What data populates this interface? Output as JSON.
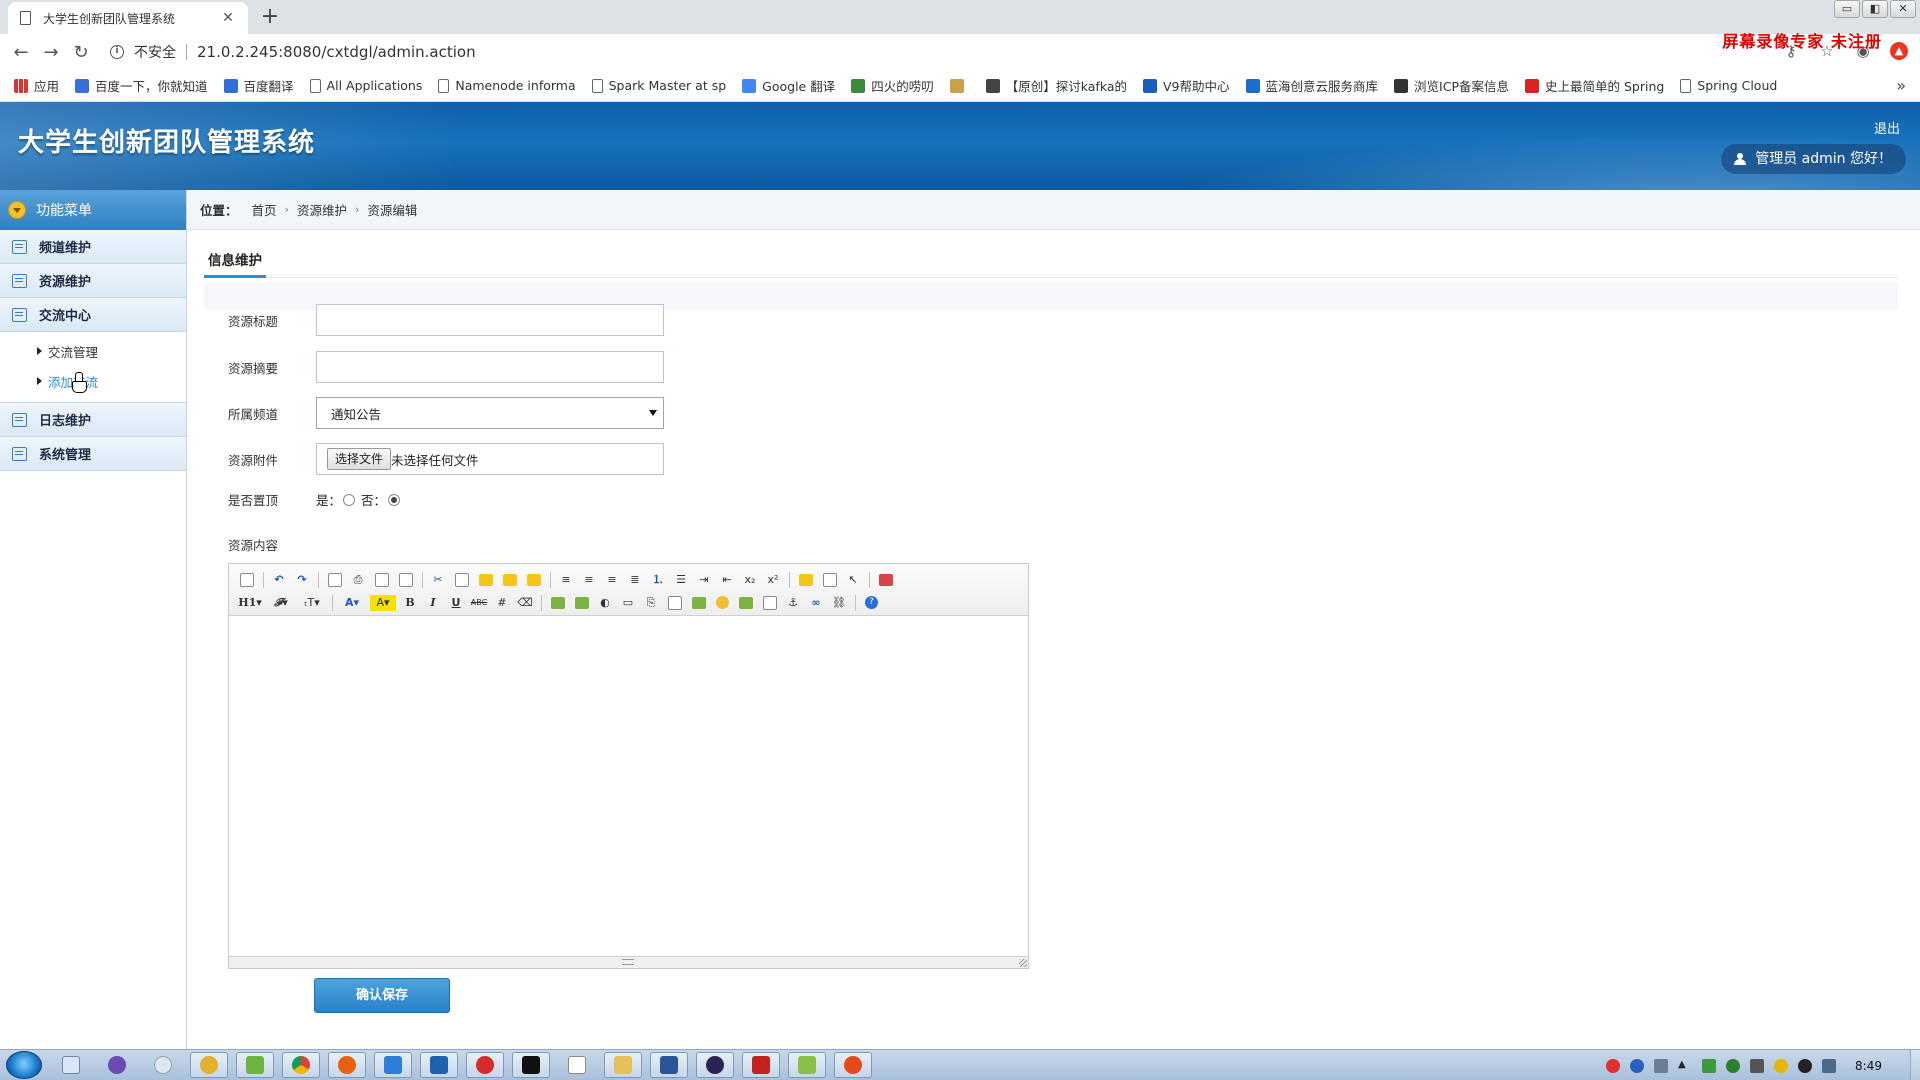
{
  "browser": {
    "tab_title": "大学生创新团队管理系统",
    "tab_close": "✕",
    "new_tab": "+",
    "back": "←",
    "forward": "→",
    "reload": "↻",
    "security_icon": "info-circle-icon",
    "security_label": "不安全",
    "url": "21.0.2.245:8080/cxtdgl/admin.action",
    "window_controls": [
      "▭",
      "◧",
      "✕"
    ],
    "bookmarks": [
      {
        "icon": "apps-icon",
        "label": "应用"
      },
      {
        "icon": "baidu-paw-icon",
        "label": "百度一下，你就知道"
      },
      {
        "icon": "baidu-fanyi-icon",
        "label": "百度翻译"
      },
      {
        "icon": "document-icon",
        "label": "All Applications"
      },
      {
        "icon": "document-icon",
        "label": "Namenode informa"
      },
      {
        "icon": "document-icon",
        "label": "Spark Master at sp"
      },
      {
        "icon": "google-translate-icon",
        "label": "Google 翻译"
      },
      {
        "icon": "fire-icon",
        "label": "四火的唠叨"
      },
      {
        "icon": "image-icon",
        "label": ""
      },
      {
        "icon": "g-icon",
        "label": "【原创】探讨kafka的"
      },
      {
        "icon": "pc-icon",
        "label": "V9帮助中心"
      },
      {
        "icon": "vsd-icon",
        "label": "蓝海创意云服务商库"
      },
      {
        "icon": "cc-icon",
        "label": "浏览ICP备案信息"
      },
      {
        "icon": "c-icon",
        "label": "史上最简单的 Spring"
      },
      {
        "icon": "document-icon",
        "label": "Spring Cloud"
      }
    ],
    "bookmarks_more": "»"
  },
  "watermark": "屏幕录像专家 未注册",
  "header": {
    "title": "大学生创新团队管理系统",
    "logout": "退出",
    "welcome": "管理员 admin 您好！"
  },
  "sidebar": {
    "title": "功能菜单",
    "items": [
      {
        "label": "频道维护"
      },
      {
        "label": "资源维护"
      },
      {
        "label": "交流中心"
      },
      {
        "label": "日志维护"
      },
      {
        "label": "系统管理"
      }
    ],
    "sub_items": [
      {
        "label": "交流管理"
      },
      {
        "label": "添加交流"
      }
    ]
  },
  "breadcrumb": {
    "label": "位置：",
    "items": [
      "首页",
      "资源维护",
      "资源编辑"
    ],
    "separator": "›"
  },
  "form": {
    "tab": "信息维护",
    "title_label": "资源标题",
    "title_value": "",
    "summary_label": "资源摘要",
    "summary_value": "",
    "channel_label": "所属频道",
    "channel_value": "通知公告",
    "attachment_label": "资源附件",
    "file_button": "选择文件",
    "file_status": "未选择任何文件",
    "top_label": "是否置顶",
    "top_yes": "是：",
    "top_no": "否：",
    "top_selected": "否",
    "content_label": "资源内容",
    "save_button": "确认保存"
  },
  "editor_toolbar": {
    "row1": [
      "source-icon",
      "undo-icon",
      "redo-icon",
      "preview-icon",
      "print-icon",
      "template-icon",
      "code-icon",
      "cut-icon",
      "copy-icon",
      "paste-icon",
      "paste-plain-icon",
      "paste-word-icon",
      "align-left-icon",
      "align-center-icon",
      "align-right-icon",
      "justify-icon",
      "ordered-list-icon",
      "unordered-list-icon",
      "indent-icon",
      "outdent-icon",
      "subscript-icon",
      "superscript-icon",
      "clear-format-icon",
      "select-all-icon",
      "select-icon",
      "fullscreen-icon"
    ],
    "heading": "H1▾",
    "font_family": "𝓕▾",
    "font_size": "ₜT▾",
    "font_color": "A▾",
    "highlight": "A▾",
    "bold": "B",
    "italic": "I",
    "underline": "U",
    "strikethrough": "ABC",
    "help": "?"
  },
  "taskbar": {
    "clock": "8:49"
  }
}
